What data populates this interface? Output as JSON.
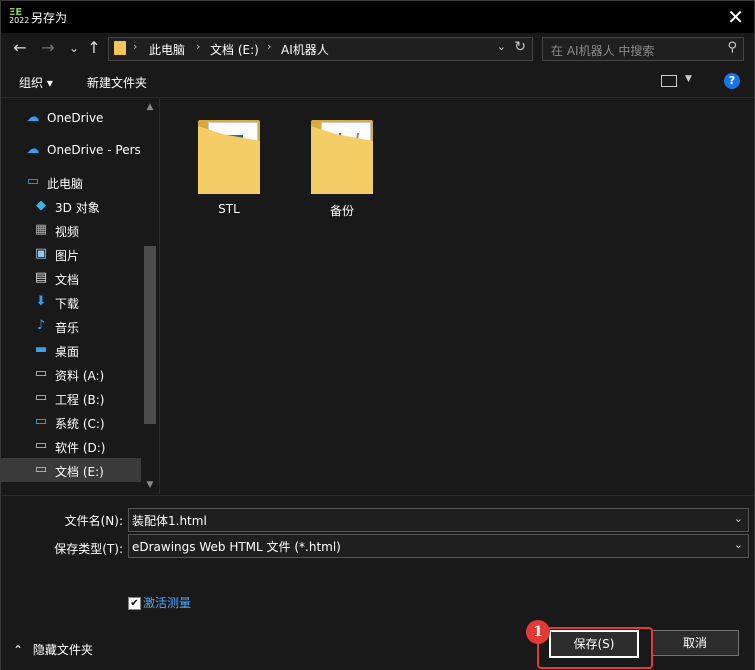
{
  "window": {
    "title": "另存为",
    "app_icon_text": "2022",
    "close": "✕"
  },
  "nav": {
    "back": "←",
    "forward": "→",
    "recent": "⌄",
    "up": "↑",
    "breadcrumb": [
      "此电脑",
      "文档 (E:)",
      "AI机器人"
    ],
    "search_placeholder": "在 AI机器人 中搜索"
  },
  "toolbar": {
    "organize": "组织 ▾",
    "new_folder": "新建文件夹",
    "help": "?"
  },
  "sidebar": {
    "items": [
      {
        "label": "OneDrive",
        "icon": "cloud-icon"
      },
      {
        "label": "OneDrive - Perso",
        "icon": "cloud-icon"
      },
      {
        "label": "此电脑",
        "icon": "computer-icon"
      },
      {
        "label": "3D 对象",
        "icon": "cube-icon"
      },
      {
        "label": "视频",
        "icon": "video-icon"
      },
      {
        "label": "图片",
        "icon": "picture-icon"
      },
      {
        "label": "文档",
        "icon": "document-icon"
      },
      {
        "label": "下载",
        "icon": "download-icon"
      },
      {
        "label": "音乐",
        "icon": "music-icon"
      },
      {
        "label": "桌面",
        "icon": "desktop-icon"
      },
      {
        "label": "资料 (A:)",
        "icon": "drive-icon"
      },
      {
        "label": "工程 (B:)",
        "icon": "drive-icon"
      },
      {
        "label": "系统 (C:)",
        "icon": "drive-icon"
      },
      {
        "label": "软件 (D:)",
        "icon": "drive-icon"
      },
      {
        "label": "文档 (E:)",
        "icon": "drive-icon"
      }
    ]
  },
  "files": [
    {
      "name": "STL"
    },
    {
      "name": "备份"
    }
  ],
  "form": {
    "filename_label": "文件名(N):",
    "filename_value": "装配体1.html",
    "filetype_label": "保存类型(T):",
    "filetype_value": "eDrawings Web HTML 文件 (*.html)",
    "activate_label": "激活测量",
    "hide_folders": "隐藏文件夹"
  },
  "buttons": {
    "save": "保存(S)",
    "cancel": "取消"
  },
  "annotation": {
    "badge": "1"
  }
}
